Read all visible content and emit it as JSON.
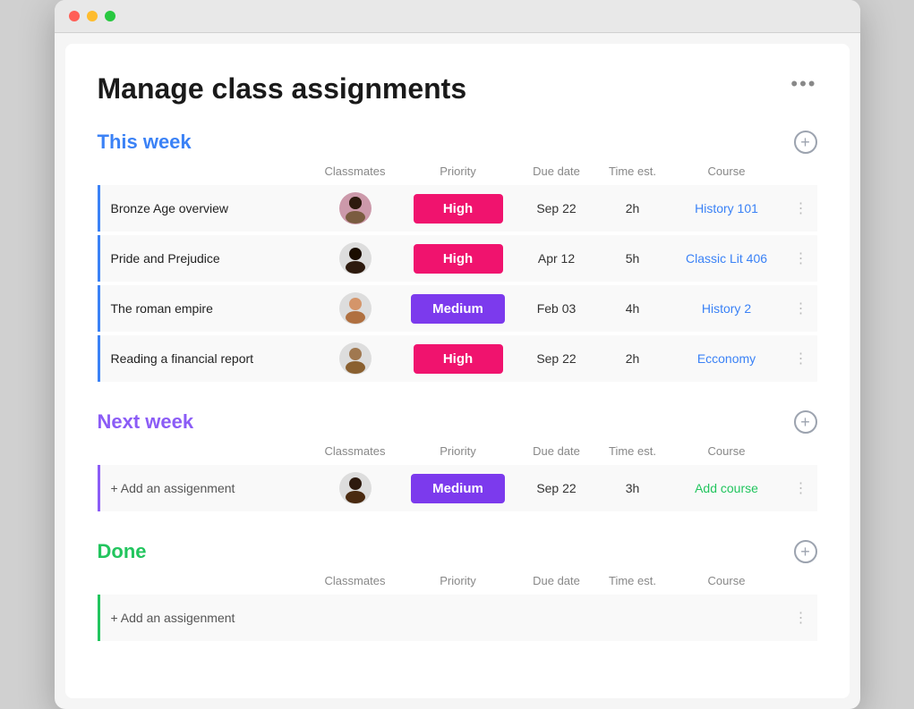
{
  "window": {
    "titlebar": {
      "dots": [
        "red",
        "yellow",
        "green"
      ]
    }
  },
  "page": {
    "title": "Manage class assignments",
    "more_icon": "•••"
  },
  "sections": [
    {
      "id": "this-week",
      "title": "This week",
      "color": "blue",
      "columns": {
        "classmates": "Classmates",
        "priority": "Priority",
        "due_date": "Due date",
        "time_est": "Time est.",
        "course": "Course"
      },
      "rows": [
        {
          "task": "Bronze Age overview",
          "avatar": "👩🏿",
          "priority": "High",
          "priority_type": "high",
          "due_date": "Sep 22",
          "time_est": "2h",
          "course": "History 101",
          "course_color": "blue"
        },
        {
          "task": "Pride and Prejudice",
          "avatar": "👨🏿",
          "priority": "High",
          "priority_type": "high",
          "due_date": "Apr 12",
          "time_est": "5h",
          "course": "Classic Lit 406",
          "course_color": "blue"
        },
        {
          "task": "The roman empire",
          "avatar": "👩🏼",
          "priority": "Medium",
          "priority_type": "medium",
          "due_date": "Feb 03",
          "time_est": "4h",
          "course": "History 2",
          "course_color": "blue"
        },
        {
          "task": "Reading a financial report",
          "avatar": "👨🏽",
          "priority": "High",
          "priority_type": "high",
          "due_date": "Sep 22",
          "time_est": "2h",
          "course": "Ecconomy",
          "course_color": "blue"
        }
      ]
    },
    {
      "id": "next-week",
      "title": "Next week",
      "color": "purple",
      "columns": {
        "classmates": "Classmates",
        "priority": "Priority",
        "due_date": "Due date",
        "time_est": "Time est.",
        "course": "Course"
      },
      "add_row": {
        "label": "+ Add an  assigenment",
        "avatar": "👩🏿",
        "priority": "Medium",
        "priority_type": "medium",
        "due_date": "Sep 22",
        "time_est": "3h",
        "course": "Add course",
        "course_color": "green"
      }
    },
    {
      "id": "done",
      "title": "Done",
      "color": "green",
      "columns": {
        "classmates": "Classmates",
        "priority": "Priority",
        "due_date": "Due date",
        "time_est": "Time est.",
        "course": "Course"
      },
      "add_row": {
        "label": "+ Add an  assigenment"
      }
    }
  ]
}
